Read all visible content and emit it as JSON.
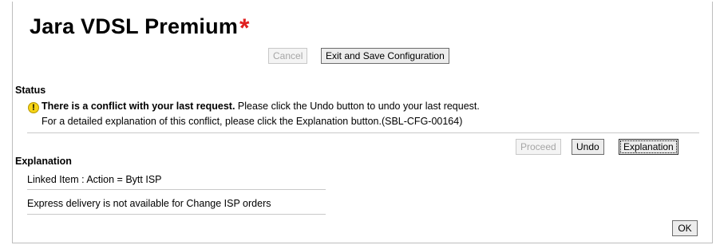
{
  "header": {
    "title": "Jara VDSL Premium",
    "required_marker": "*"
  },
  "toolbar": {
    "cancel_label": "Cancel",
    "exit_save_label": "Exit and Save Configuration"
  },
  "status": {
    "heading": "Status",
    "conflict_bold": "There is a conflict with your last request.",
    "conflict_rest": " Please click the Undo button to undo your last request.",
    "detail": "For a detailed explanation of this conflict, please click the Explanation button.(SBL-CFG-00164)"
  },
  "actions": {
    "proceed_label": "Proceed",
    "undo_label": "Undo",
    "explanation_label": "Explanation"
  },
  "explanation": {
    "heading": "Explanation",
    "rows": [
      "Linked Item : Action = Bytt ISP",
      "Express delivery is not available for Change ISP orders"
    ]
  },
  "footer": {
    "ok_label": "OK"
  }
}
